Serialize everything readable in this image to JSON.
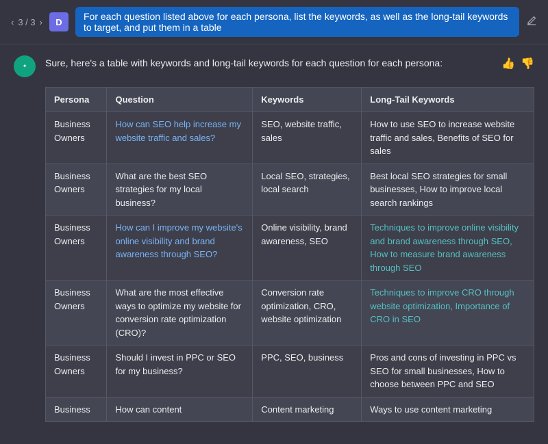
{
  "topbar": {
    "nav_prev": "‹",
    "nav_next": "›",
    "nav_count": "3 / 3",
    "avatar_label": "D",
    "prompt_text": "For each question listed above for each persona, list the keywords, as well as the long-tail keywords to target, and put them in a table",
    "edit_icon": "⊘"
  },
  "response": {
    "intro_text": "Sure, here's a table with keywords and long-tail keywords for each question for each persona:",
    "table": {
      "headers": [
        "Persona",
        "Question",
        "Keywords",
        "Long-Tail Keywords"
      ],
      "rows": [
        {
          "persona": "Business Owners",
          "question": "How can SEO help increase my website traffic and sales?",
          "keywords": "SEO, website traffic, sales",
          "longtail": "How to use SEO to increase website traffic and sales, Benefits of SEO for sales",
          "q_highlight": true,
          "lt_highlight": false
        },
        {
          "persona": "Business Owners",
          "question": "What are the best SEO strategies for my local business?",
          "keywords": "Local SEO, strategies, local search",
          "longtail": "Best local SEO strategies for small businesses, How to improve local search rankings",
          "q_highlight": false,
          "lt_highlight": false
        },
        {
          "persona": "Business Owners",
          "question": "How can I improve my website's online visibility and brand awareness through SEO?",
          "keywords": "Online visibility, brand awareness, SEO",
          "longtail": "Techniques to improve online visibility and brand awareness through SEO, How to measure brand awareness through SEO",
          "q_highlight": true,
          "lt_highlight": true
        },
        {
          "persona": "Business Owners",
          "question": "What are the most effective ways to optimize my website for conversion rate optimization (CRO)?",
          "keywords": "Conversion rate optimization, CRO, website optimization",
          "longtail": "Techniques to improve CRO through website optimization, Importance of CRO in SEO",
          "q_highlight": false,
          "lt_highlight": true
        },
        {
          "persona": "Business Owners",
          "question": "Should I invest in PPC or SEO for my business?",
          "keywords": "PPC, SEO, business",
          "longtail": "Pros and cons of investing in PPC vs SEO for small businesses, How to choose between PPC and SEO",
          "q_highlight": false,
          "lt_highlight": false
        },
        {
          "persona": "Business",
          "question": "How can content",
          "keywords": "Content marketing",
          "longtail": "Ways to use content marketing",
          "q_highlight": false,
          "lt_highlight": false
        }
      ]
    }
  }
}
